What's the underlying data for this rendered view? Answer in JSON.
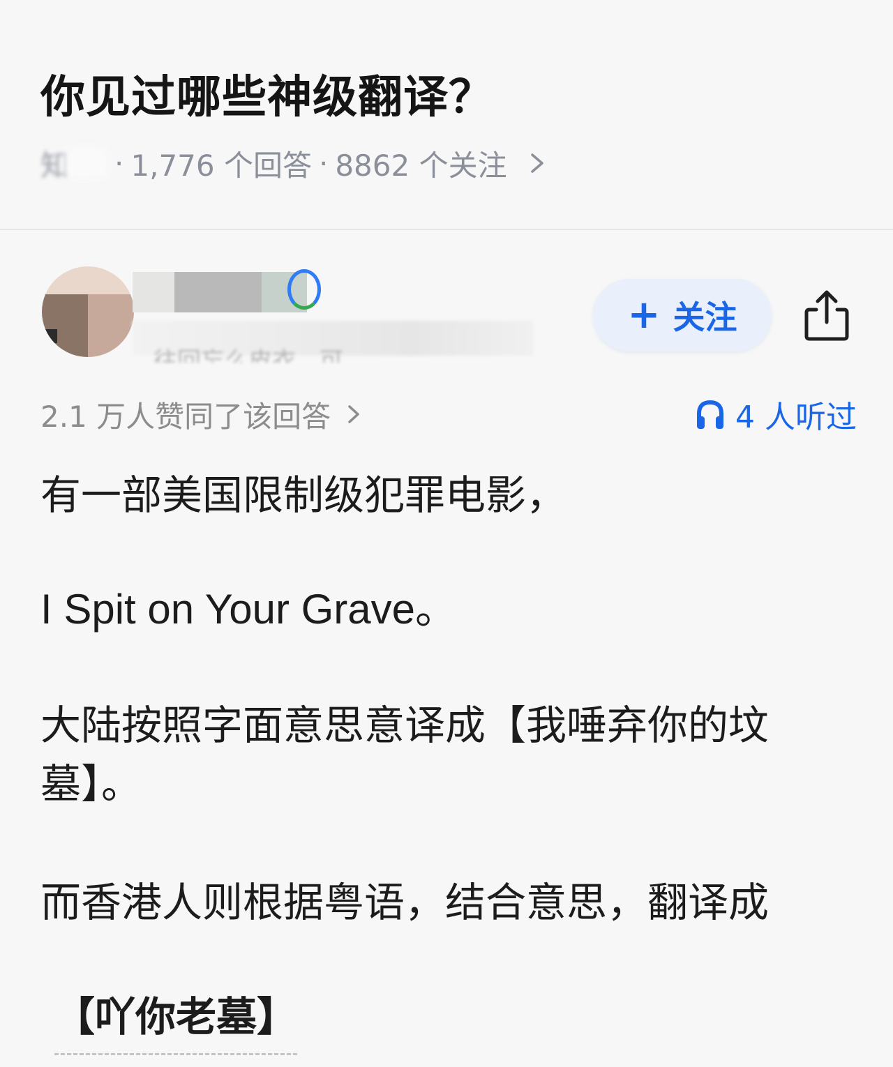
{
  "question": {
    "title": "你见过哪些神级翻译？",
    "topic": "知",
    "answers_count": "1,776 个回答",
    "followers_count": "8862 个关注",
    "separator": "·"
  },
  "answer": {
    "author_bio_tail": "往回忘么皮衣，可 ...",
    "follow_button_label": "关注",
    "follow_plus": "+",
    "upvote_text": "2.1 万人赞同了该回答",
    "listen_text": "4 人听过",
    "paragraphs": [
      "有一部美国限制级犯罪电影，",
      "I Spit on Your Grave。",
      "大陆按照字面意思意译成【我唾弃你的坟墓】。",
      "而香港人则根据粤语，结合意思，翻译成",
      "【吖你老墓】"
    ]
  },
  "colors": {
    "accent_blue": "#1a66e6",
    "follow_bg": "#e9f0fb",
    "meta_gray": "#8a8f99",
    "background": "#f7f7f7"
  },
  "icons": {
    "meta_chevron": "chevron-right-icon",
    "upvote_chevron": "chevron-right-icon",
    "share": "share-icon",
    "listen": "headphone-icon"
  }
}
